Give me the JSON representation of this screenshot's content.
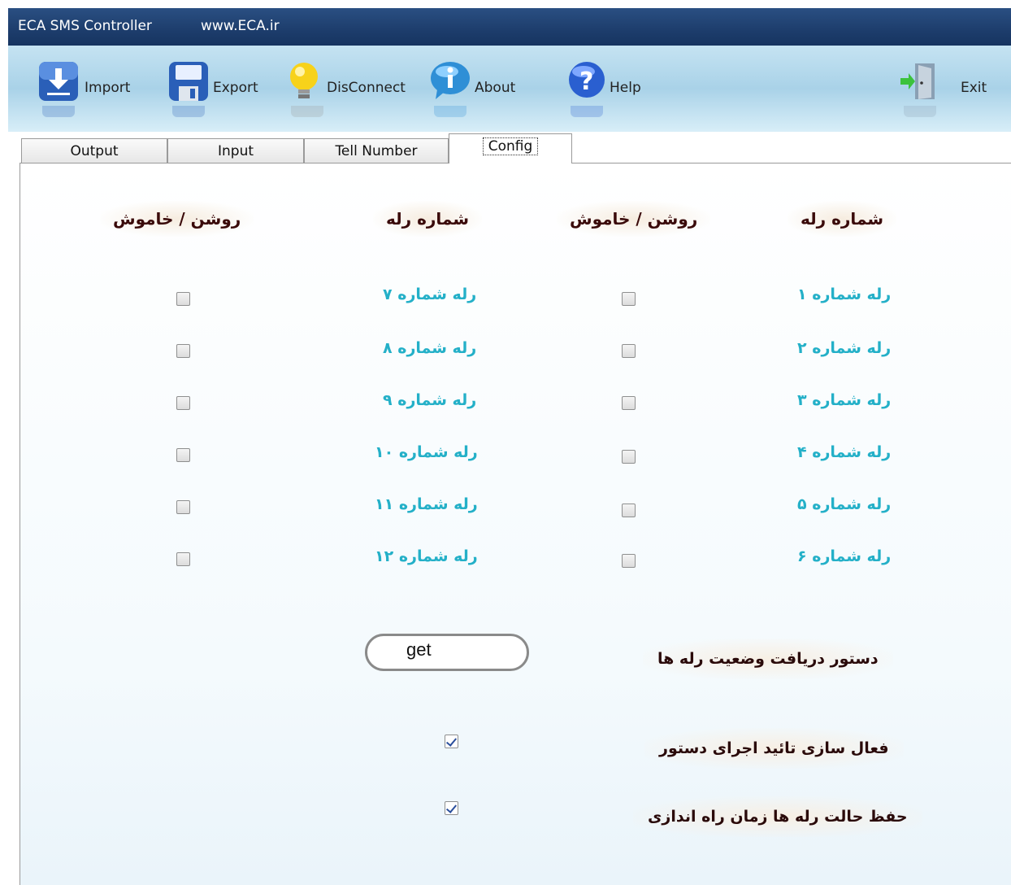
{
  "window": {
    "title": "ECA SMS Controller",
    "site": "www.ECA.ir"
  },
  "toolbar": {
    "import": "Import",
    "export": "Export",
    "disconnect": "DisConnect",
    "about": "About",
    "help": "Help",
    "exit": "Exit"
  },
  "tabs": [
    "Output",
    "Input",
    "Tell Number",
    "Config"
  ],
  "active_tab": "Config",
  "config": {
    "col_headers": {
      "relay_number": "شماره رله",
      "on_off": "روشن / خاموش"
    },
    "relays_right": [
      {
        "label": "رله شماره ۱",
        "checked": false
      },
      {
        "label": "رله شماره ۲",
        "checked": false
      },
      {
        "label": "رله شماره ۳",
        "checked": false
      },
      {
        "label": "رله شماره ۴",
        "checked": false
      },
      {
        "label": "رله شماره ۵",
        "checked": false
      },
      {
        "label": "رله شماره ۶",
        "checked": false
      }
    ],
    "relays_left": [
      {
        "label": "رله شماره ۷",
        "checked": false
      },
      {
        "label": "رله شماره ۸",
        "checked": false
      },
      {
        "label": "رله شماره ۹",
        "checked": false
      },
      {
        "label": "رله شماره ۱۰",
        "checked": false
      },
      {
        "label": "رله شماره ۱۱",
        "checked": false
      },
      {
        "label": "رله شماره ۱۲",
        "checked": false
      }
    ],
    "status_command_label": "دستور دریافت وضعیت رله ها",
    "status_command_value": "get",
    "confirm_label": "فعال سازی تائید اجرای دستور",
    "confirm_checked": true,
    "save_state_label": "حفظ حالت رله ها زمان راه اندازی",
    "save_state_checked": true
  },
  "colors": {
    "titlebar": "#1d3d6c",
    "toolbar": "#a9d2e8",
    "relay_label": "#24b0c8",
    "header_text": "#3a0a0a"
  }
}
